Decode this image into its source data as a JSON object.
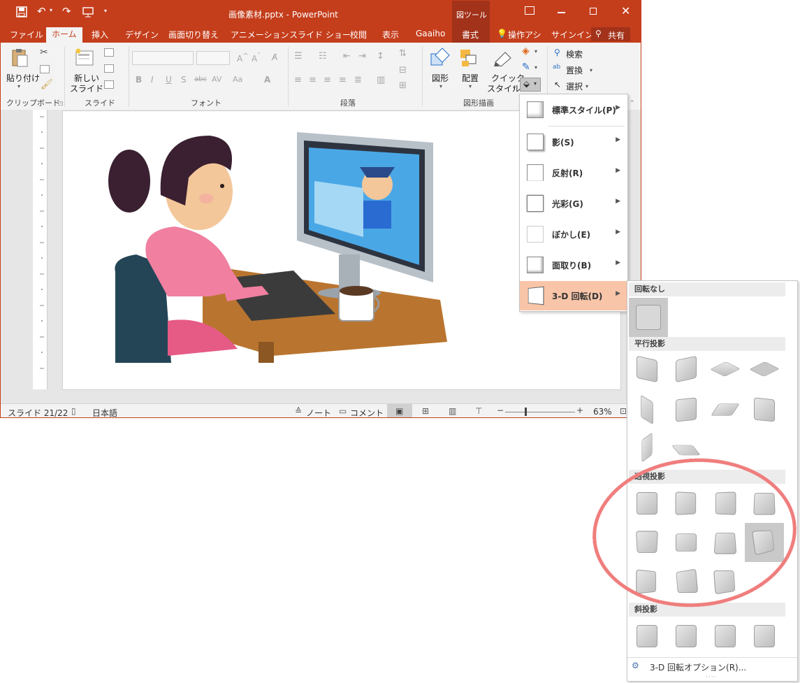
{
  "window": {
    "title": "画像素材.pptx - PowerPoint",
    "contextual_group": "図ツール",
    "sign_in": "サインイン",
    "share": "共有",
    "tell_me": "操作アシ"
  },
  "tabs": [
    "ファイル",
    "ホーム",
    "挿入",
    "デザイン",
    "画面切り替え",
    "アニメーション",
    "スライド ショー",
    "校閲",
    "表示",
    "Gaaiho",
    "書式"
  ],
  "ribbon": {
    "paste": "貼り付け",
    "new_slide_1": "新しい",
    "new_slide_2": "スライド",
    "shapes": "図形",
    "arrange": "配置",
    "quick_style_1": "クイック",
    "quick_style_2": "スタイル",
    "find": "検索",
    "replace": "置換",
    "select": "選択",
    "groups": {
      "clipboard": "クリップボード",
      "slides": "スライド",
      "font": "フォント",
      "paragraph": "段落",
      "drawing": "図形描画"
    }
  },
  "status": {
    "slide": "スライド 21/22",
    "language": "日本語",
    "notes": "ノート",
    "comments": "コメント",
    "zoom": "63%",
    "zoom_value_percent": 63
  },
  "effects_menu": [
    {
      "label": "標準スタイル(P)",
      "highlighted": false
    },
    {
      "label": "影(S)",
      "highlighted": false
    },
    {
      "label": "反射(R)",
      "highlighted": false
    },
    {
      "label": "光彩(G)",
      "highlighted": false
    },
    {
      "label": "ぼかし(E)",
      "highlighted": false
    },
    {
      "label": "面取り(B)",
      "highlighted": false
    },
    {
      "label": "3-D 回転(D)",
      "highlighted": true
    }
  ],
  "rotation_gallery": {
    "no_rotation": "回転なし",
    "parallel": "平行投影",
    "perspective": "透視投影",
    "oblique": "斜投影",
    "options": "3-D 回転オプション(R)..."
  },
  "colors": {
    "accent": "#c43e1c",
    "highlight": "#f9c5a8",
    "annotation": "#f07d7d"
  }
}
